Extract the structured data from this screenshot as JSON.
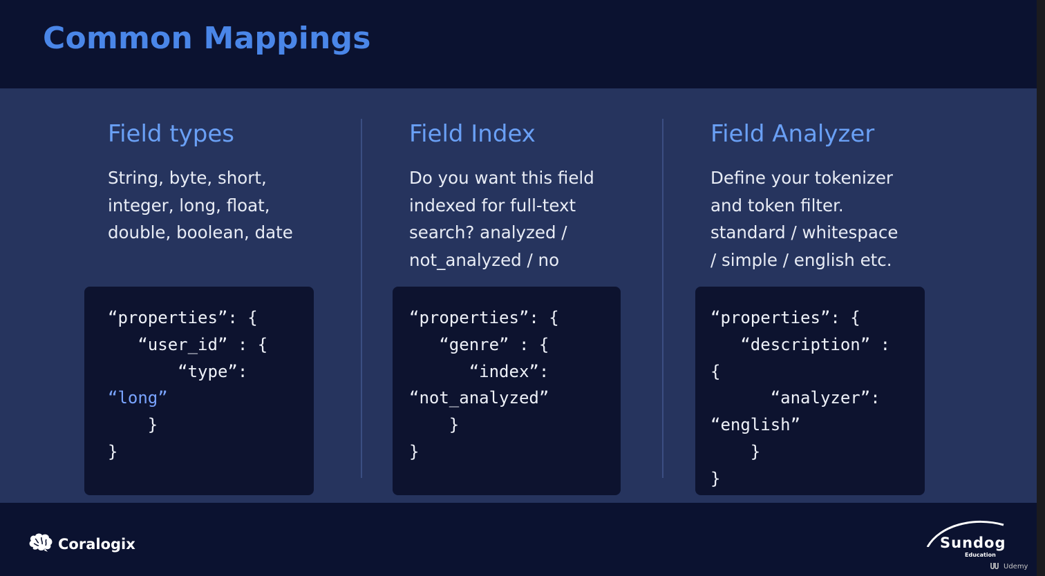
{
  "slide": {
    "title": "Common Mappings"
  },
  "columns": [
    {
      "title": "Field types",
      "description": "String, byte, short,\ninteger, long, float,\ndouble, boolean, date",
      "code": {
        "line1": "“properties”: {",
        "line2": "   “user_id” : {",
        "line3": "       “type”:",
        "line4_value": "“long”",
        "line5": "    }",
        "line6": "}"
      }
    },
    {
      "title": "Field Index",
      "description": "Do you want this field\nindexed for full-text\nsearch?  analyzed /\nnot_analyzed / no",
      "code": {
        "line1": "“properties”: {",
        "line2": "   “genre” : {",
        "line3": "      “index”:",
        "line4": "“not_analyzed”",
        "line5": "    }",
        "line6": "}"
      }
    },
    {
      "title": "Field Analyzer",
      "description": "Define your tokenizer\nand token filter.\nstandard / whitespace\n/ simple / english etc.",
      "code": {
        "line1": "“properties”: {",
        "line2": "   “description” :",
        "line3": "{",
        "line4": "      “analyzer”:",
        "line5": "“english”",
        "line6": "    }",
        "line7": "}"
      }
    }
  ],
  "footer": {
    "left_logo": "Coralogix",
    "right_logo": "Sundog",
    "right_logo_sub": "Education",
    "watermark": "Udemy"
  },
  "icons": {
    "brain": "brain-icon",
    "udemy": "udemy-icon"
  },
  "colors": {
    "title": "#4a86e8",
    "column_title": "#6aa0f5",
    "code_value": "#7aa4ff",
    "main_bg": "#26345e",
    "header_bg": "#0b1230",
    "code_bg": "#0d132f"
  }
}
